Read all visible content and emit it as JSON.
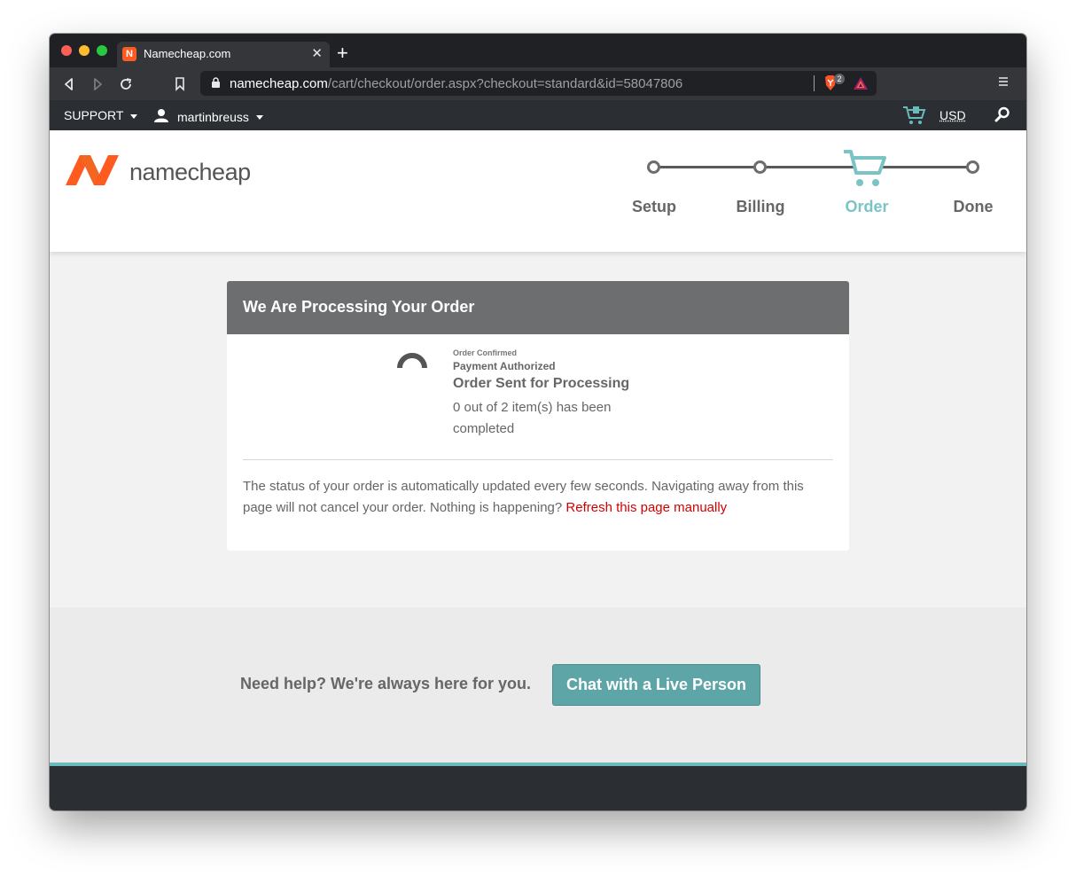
{
  "browser": {
    "tab_title": "Namecheap.com",
    "url_host": "namecheap.com",
    "url_path": "/cart/checkout/order.aspx?checkout=standard&id=58047806",
    "brave_badge": "2"
  },
  "sitebar": {
    "support_label": "SUPPORT",
    "username": "martinbreuss",
    "currency": "USD"
  },
  "header": {
    "logo_text": "namecheap",
    "steps": [
      {
        "label": "Setup",
        "state": "done"
      },
      {
        "label": "Billing",
        "state": "done"
      },
      {
        "label": "Order",
        "state": "active"
      },
      {
        "label": "Done",
        "state": "pending"
      }
    ],
    "active_color": "#7ac4c6"
  },
  "panel": {
    "title": "We Are Processing Your Order",
    "status_confirmed": "Order Confirmed",
    "status_authorized": "Payment Authorized",
    "status_sent": "Order Sent for Processing",
    "status_count": "0 out of 2 item(s) has been completed",
    "note": "The status of your order is automatically updated every few seconds. Navigating away from this page will not cancel your order. Nothing is happening?",
    "refresh_link": "Refresh this page manually"
  },
  "help": {
    "text": "Need help? We're always here for you.",
    "chat_button": "Chat with a Live Person"
  },
  "icons": [
    "back-icon",
    "forward-icon",
    "reload-icon",
    "bookmark-icon",
    "lock-icon",
    "brave-shield-icon",
    "rewards-icon",
    "menu-icon",
    "user-icon",
    "cart-icon",
    "search-icon",
    "spinner-icon"
  ]
}
